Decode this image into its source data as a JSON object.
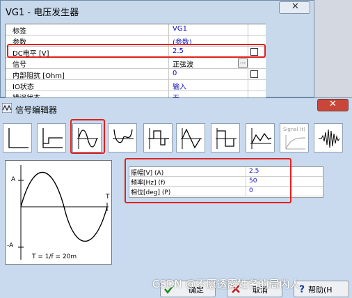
{
  "main_window": {
    "title": "VG1 - 电压发生器",
    "close_glyph": "✕",
    "properties": [
      {
        "label": "标签",
        "value": "VG1"
      },
      {
        "label": "参数",
        "value": "(参数)"
      },
      {
        "label": "DC电平 [V]",
        "value": "2.5"
      },
      {
        "label": "信号",
        "value": "正弦波"
      },
      {
        "label": "内部阻抗 [Ohm]",
        "value": "0"
      },
      {
        "label": "IO状态",
        "value": "输入"
      },
      {
        "label": "错误状态",
        "value": "无"
      }
    ],
    "dots_label": "..."
  },
  "editor": {
    "title": "信号编辑器",
    "close_glyph": "✕",
    "toolbar_signal_label": "Signal (t)",
    "preview": {
      "a_label": "A",
      "neg_a_label": "-A",
      "t_label": "T",
      "formula": "T = 1/f = 20m"
    },
    "params": [
      {
        "label": "振幅[V] (A)",
        "value": "2.5"
      },
      {
        "label": "频率[Hz] (f)",
        "value": "50"
      },
      {
        "label": "相位[deg] (P)",
        "value": "0"
      }
    ],
    "buttons": {
      "ok": "确定",
      "cancel": "取消",
      "help": "帮助(H"
    }
  },
  "watermark": "CSDN @不愿透露姓名的局内人",
  "colors": {
    "highlight": "#e0201c",
    "value_text": "#1010c0"
  }
}
